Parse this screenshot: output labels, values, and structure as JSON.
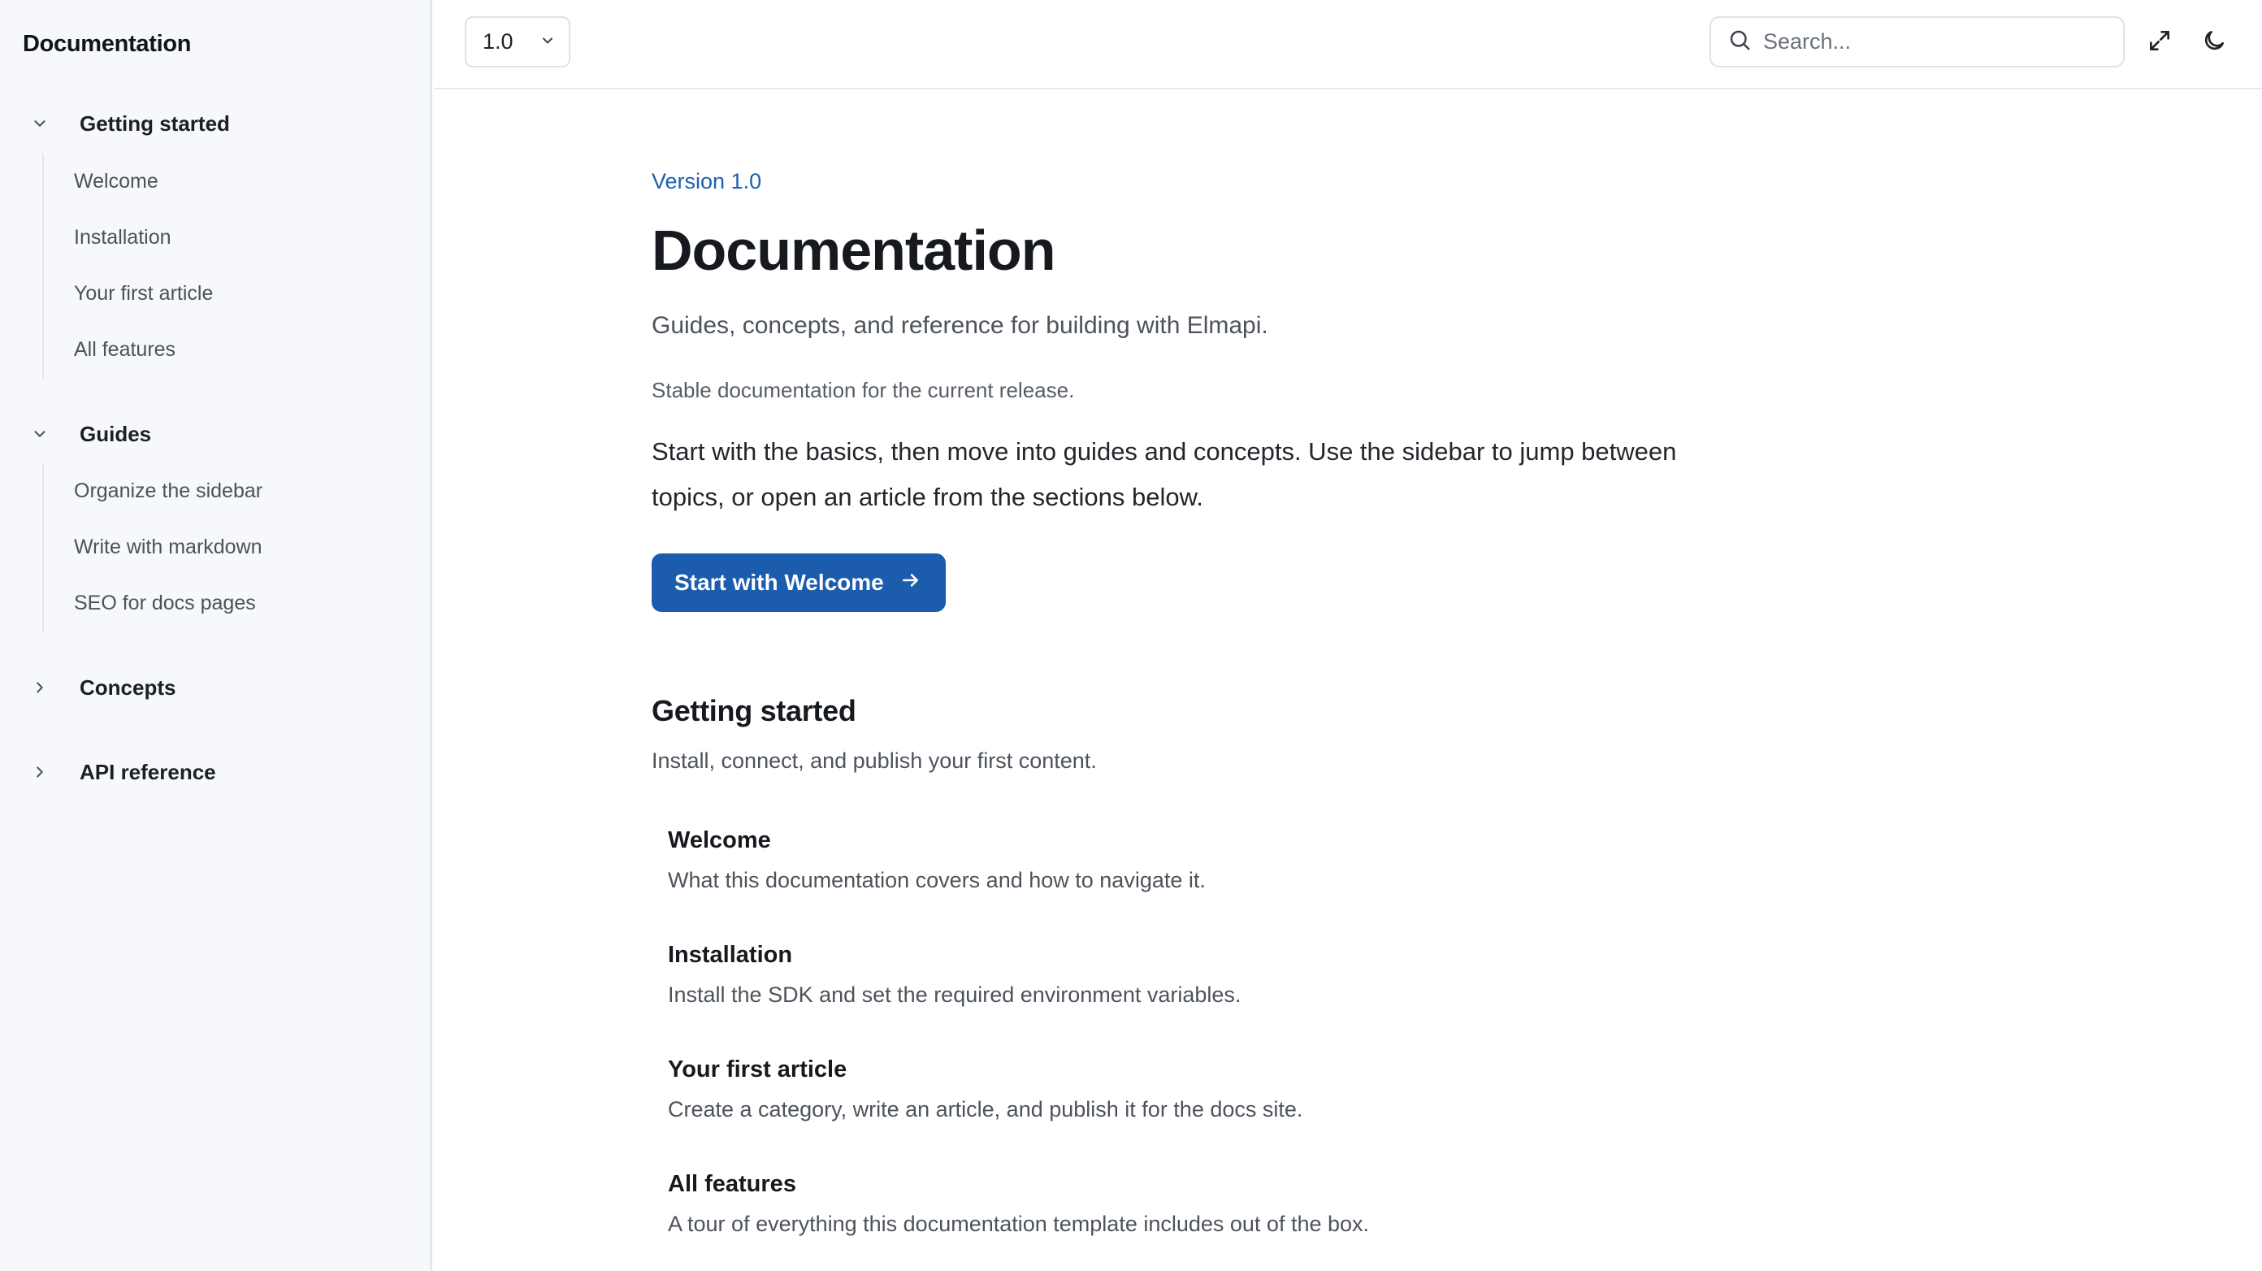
{
  "sidebar": {
    "title": "Documentation",
    "sections": [
      {
        "label": "Getting started",
        "expanded": true,
        "icon": "chevron-down-icon",
        "items": [
          "Welcome",
          "Installation",
          "Your first article",
          "All features"
        ]
      },
      {
        "label": "Guides",
        "expanded": true,
        "icon": "chevron-down-icon",
        "items": [
          "Organize the sidebar",
          "Write with markdown",
          "SEO for docs pages"
        ]
      },
      {
        "label": "Concepts",
        "expanded": false,
        "icon": "chevron-right-icon",
        "items": []
      },
      {
        "label": "API reference",
        "expanded": false,
        "icon": "chevron-right-icon",
        "items": []
      }
    ]
  },
  "topbar": {
    "version": "1.0",
    "search_placeholder": "Search...",
    "icons": [
      "chevron-down-icon",
      "search-icon",
      "expand-icon",
      "moon-icon"
    ]
  },
  "main": {
    "eyebrow": "Version 1.0",
    "title": "Documentation",
    "lead": "Guides, concepts, and reference for building with Elmapi.",
    "meta": "Stable documentation for the current release.",
    "intro": "Start with the basics, then move into guides and concepts. Use the sidebar to jump between topics, or open an article from the sections below.",
    "cta_label": "Start with Welcome",
    "section": {
      "title": "Getting started",
      "description": "Install, connect, and publish your first content.",
      "cards": [
        {
          "title": "Welcome",
          "description": "What this documentation covers and how to navigate it."
        },
        {
          "title": "Installation",
          "description": "Install the SDK and set the required environment variables."
        },
        {
          "title": "Your first article",
          "description": "Create a category, write an article, and publish it for the docs site."
        },
        {
          "title": "All features",
          "description": "A tour of everything this documentation template includes out of the box."
        }
      ]
    }
  },
  "colors": {
    "accent": "#1c5cad",
    "link": "#1d5fb0",
    "sidebar_bg": "#f6f8fb",
    "border": "#e4e7ec"
  }
}
